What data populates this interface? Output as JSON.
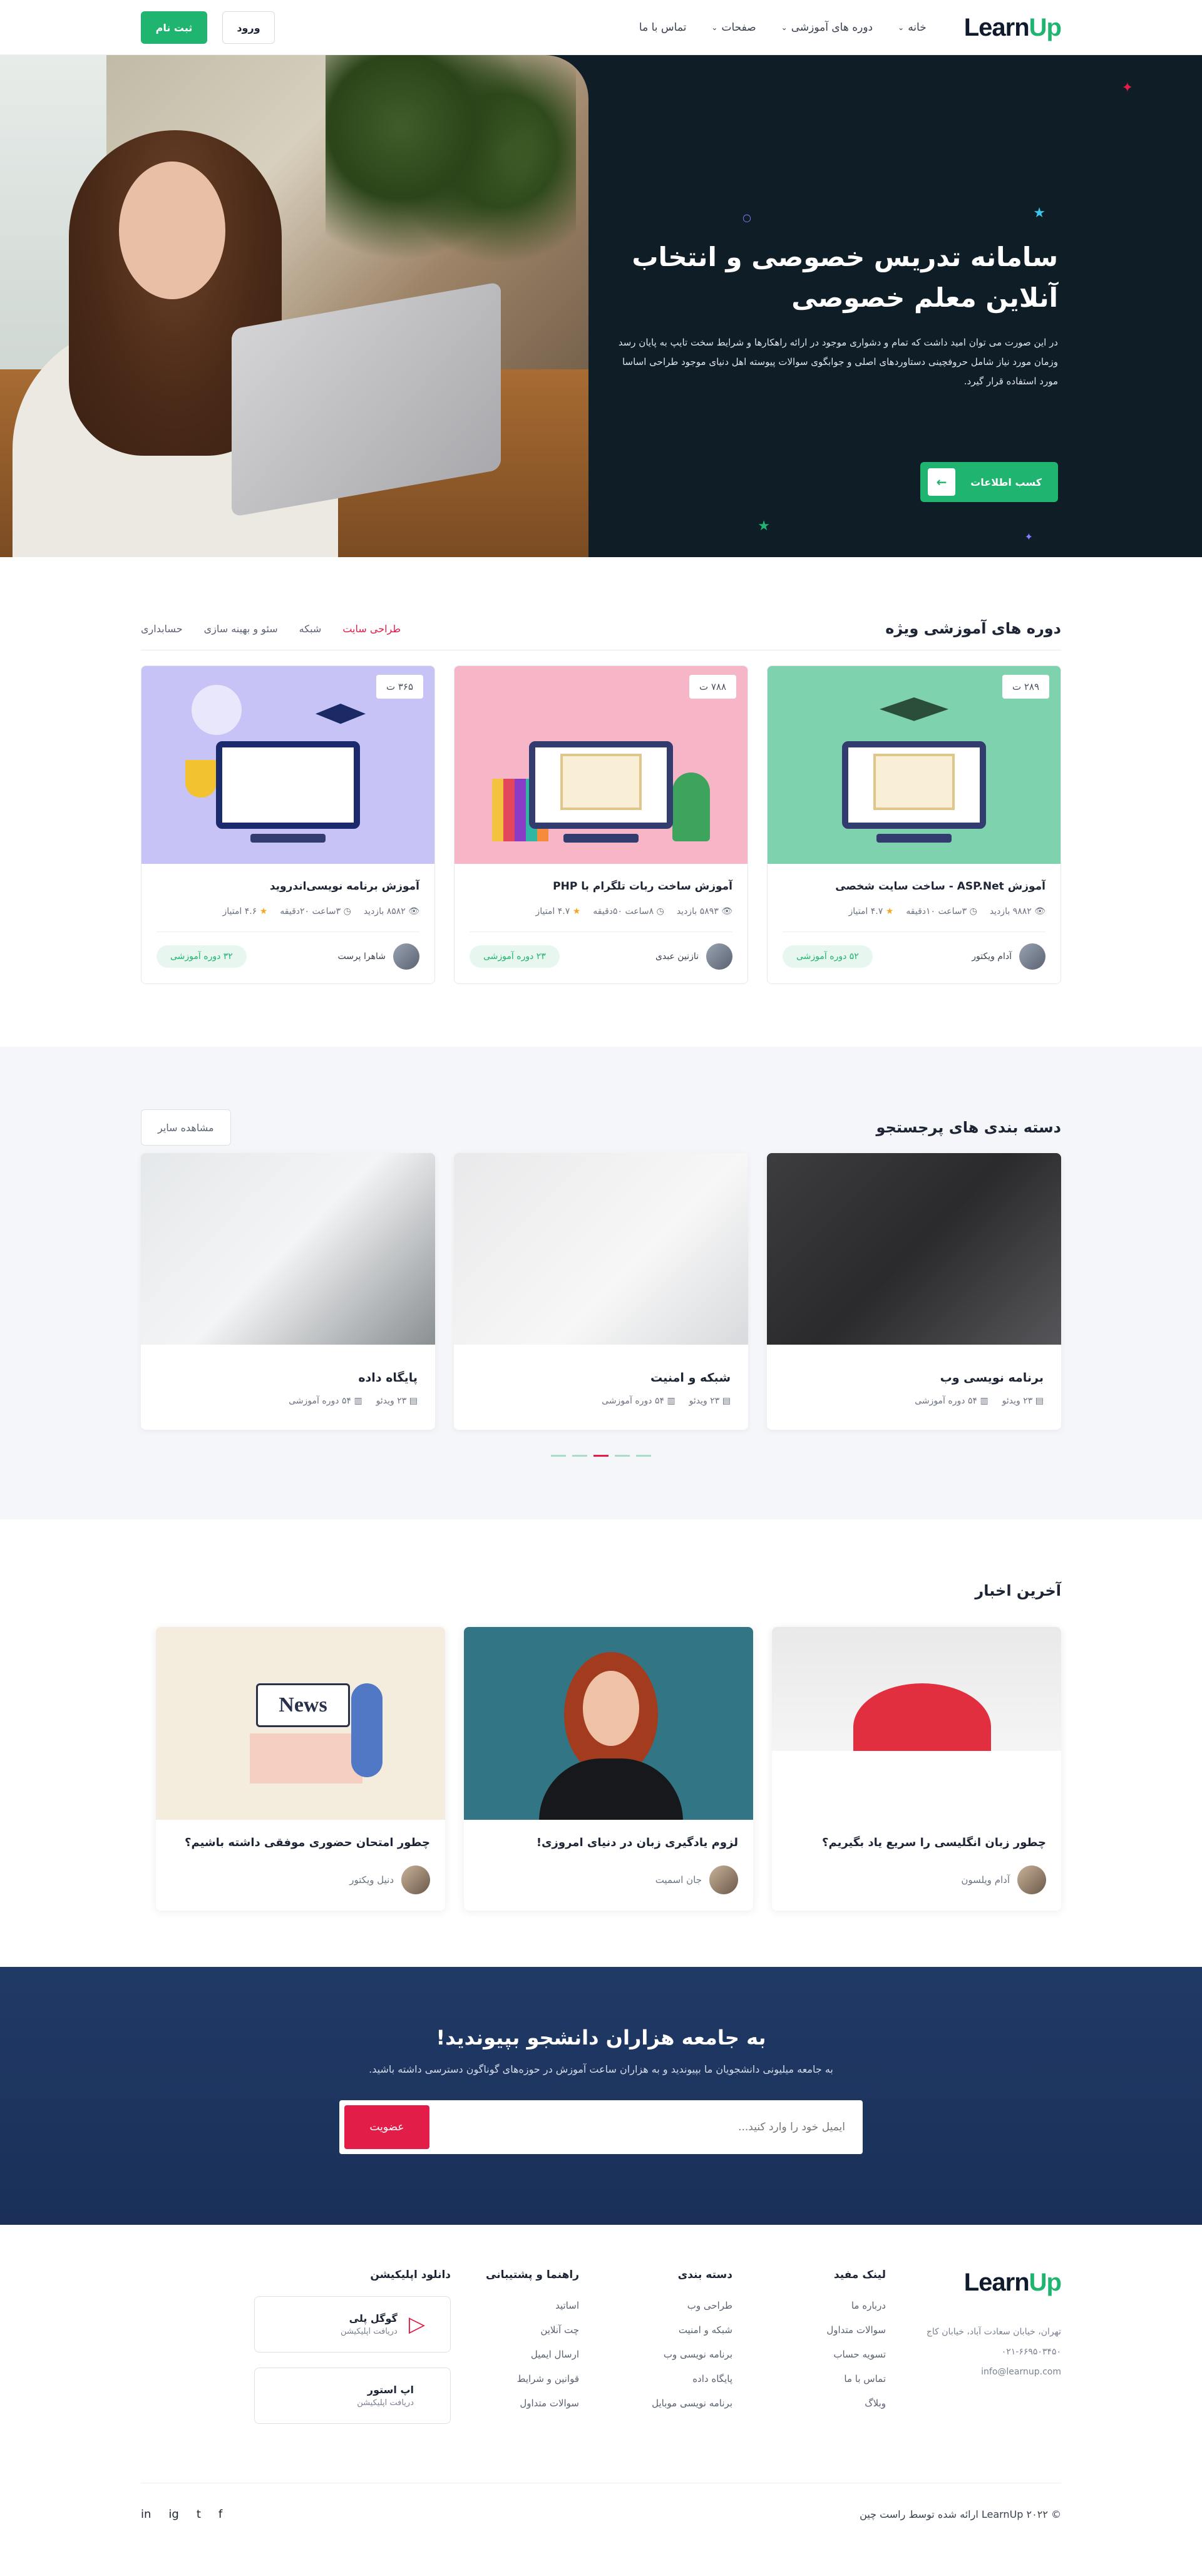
{
  "header": {
    "logo_a": "Learn",
    "logo_b": "Up",
    "nav": [
      "خانه",
      "دوره های آموزشی",
      "صفحات",
      "تماس با ما"
    ],
    "login": "ورود",
    "register": "ثبت نام"
  },
  "hero": {
    "title": "سامانه تدریس خصوصی و انتخاب آنلاین معلم خصوصی",
    "text": "در این صورت می توان امید داشت که تمام و دشواری موجود در ارائه راهکارها و شرایط سخت تایپ به پایان رسد وزمان مورد نیاز شامل حروفچینی دستاوردهای اصلی و جوابگوی سوالات پیوسته اهل دنیای موجود طراحی اساسا مورد استفاده قرار گیرد.",
    "button": "کسب اطلاعات"
  },
  "featured": {
    "title": "دوره های آموزشی ویژه",
    "tabs": [
      "طراحی سایت",
      "شبکه",
      "سئو و بهینه سازی",
      "حسابداری"
    ],
    "courses": [
      {
        "price": "۲۸۹ ت",
        "title": "آموزش ASP.Net - ساخت سایت شخصی",
        "views": "۹۸۸۲ بازدید",
        "time": "۳ساعت ۱۰دقیقه",
        "rating": "۴.۷ امتیاز",
        "teacher": "آدام ویکتور",
        "badge": "۵۲ دوره آموزشی"
      },
      {
        "price": "۷۸۸ ت",
        "title": "آموزش ساخت ربات تلگرام با PHP",
        "views": "۵۸۹۳ بازدید",
        "time": "۸ساعت ۵۰دقیقه",
        "rating": "۴.۷ امتیاز",
        "teacher": "نازنین عبدی",
        "badge": "۲۳ دوره آموزشی"
      },
      {
        "price": "۳۶۵ ت",
        "title": "آموزش برنامه نویسی‌اندروید",
        "views": "۸۵۸۲ بازدید",
        "time": "۳ساعت ۲۰دقیقه",
        "rating": "۴.۶ امتیاز",
        "teacher": "شاهرا پرست",
        "badge": "۳۲ دوره آموزشی"
      }
    ]
  },
  "popular": {
    "title": "دسته بندی های پرجستجو",
    "more": "مشاهده سایر",
    "categories": [
      {
        "title": "برنامه نویسی وب",
        "videos": "۲۳ ویدئو",
        "courses": "۵۴ دوره آموزشی"
      },
      {
        "title": "شبکه و امنیت",
        "videos": "۲۳ ویدئو",
        "courses": "۵۴ دوره آموزشی"
      },
      {
        "title": "پایگاه داده",
        "videos": "۲۳ ویدئو",
        "courses": "۵۴ دوره آموزشی"
      }
    ]
  },
  "news": {
    "title": "آخرین اخبار",
    "posts": [
      {
        "title": "چطور زبان انگلیسی را سریع یاد بگیریم؟",
        "author": "آدام ویلسون"
      },
      {
        "title": "لزوم یادگیری زبان در دنیای امروزی!",
        "author": "جان اسمیت"
      },
      {
        "title": "چطور امتحان حضوری موفقی داشته باشیم؟",
        "author": "دنیل ویکتور"
      }
    ],
    "illustration_word": "News"
  },
  "newsletter": {
    "title": "به جامعه هزاران دانشجو بپیوندید!",
    "text": "به جامعه میلیونی دانشجویان ما بپیوندید و به هزاران ساعت آموزش در حوزه‌های گوناگون دسترسی داشته باشید.",
    "placeholder": "ایمیل خود را وارد کنید...",
    "button": "عضویت"
  },
  "footer": {
    "address": "تهران، خیابان سعادت آباد، خیابان کاج",
    "phone": "۰۲۱-۶۶۹۵۰۳۴۵۰",
    "email": "info@learnup.com",
    "col1": {
      "title": "لینک مفید",
      "items": [
        "درباره ما",
        "سوالات متداول",
        "تسویه حساب",
        "تماس با ما",
        "وبلاگ"
      ]
    },
    "col2": {
      "title": "دسته بندی",
      "items": [
        "طراحی وب",
        "شبکه و امنیت",
        "برنامه نویسی وب",
        "پایگاه داده",
        "برنامه نویسی موبایل"
      ]
    },
    "col3": {
      "title": "راهنما و پشتیبانی",
      "items": [
        "اساتید",
        "چت آنلاین",
        "ارسال ایمیل",
        "قوانین و شرایط",
        "سوالات متداول"
      ]
    },
    "app": {
      "title": "دانلود اپلیکیشن",
      "google_title": "گوگل پلی",
      "google_sub": "دریافت اپلیکیشن",
      "apple_title": "اپ استور",
      "apple_sub": "دریافت اپلیکیشن"
    },
    "copyright": "© ۲۰۲۲ LearnUp ارائه شده توسط راست چین",
    "social": [
      "f",
      "t",
      "ig",
      "in"
    ]
  },
  "colors": {
    "brand_green": "#1fb46f",
    "accent_red": "#e11d48",
    "dark": "#0f1d27"
  }
}
